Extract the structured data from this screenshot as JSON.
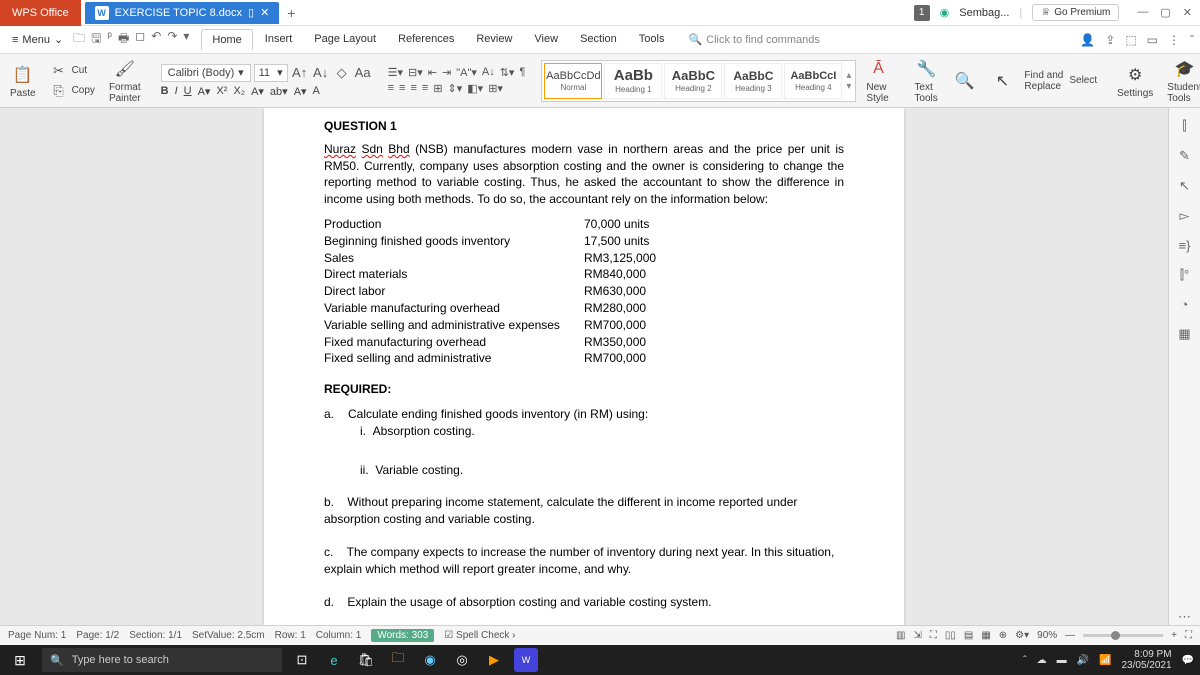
{
  "app": {
    "name": "WPS Office"
  },
  "document": {
    "filename": "EXERCISE TOPIC 8.docx"
  },
  "titlebar": {
    "user_label": "Sembag...",
    "premium_label": "Go Premium",
    "badge": "1"
  },
  "menubar": {
    "menu_label": "Menu",
    "tabs": [
      "Home",
      "Insert",
      "Page Layout",
      "References",
      "Review",
      "View",
      "Section",
      "Tools"
    ],
    "active_tab": "Home",
    "search_placeholder": "Click to find commands"
  },
  "ribbon": {
    "cut": "Cut",
    "copy": "Copy",
    "paste": "Paste",
    "format_painter": "Format\nPainter",
    "font_name": "Calibri (Body)",
    "font_size": "11",
    "styles": [
      {
        "preview": "AaBbCcDd",
        "name": "Normal"
      },
      {
        "preview": "AaBb",
        "name": "Heading 1"
      },
      {
        "preview": "AaBbC",
        "name": "Heading 2"
      },
      {
        "preview": "AaBbC",
        "name": "Heading 3"
      },
      {
        "preview": "AaBbCcI",
        "name": "Heading 4"
      }
    ],
    "new_style": "New Style",
    "text_tools": "Text Tools",
    "find_replace": "Find and\nReplace",
    "select": "Select",
    "settings": "Settings",
    "student_tools": "Student Tools"
  },
  "doc": {
    "q_title": "QUESTION 1",
    "para": "Nuraz Sdn Bhd (NSB) manufactures modern vase in northern areas and the price per unit is RM50. Currently, company uses absorption costing and the owner is considering to change the reporting method to variable costing. Thus, he asked the accountant to show the difference in income using both methods. To do so, the accountant rely on the information below:",
    "table": [
      [
        "Production",
        "70,000 units"
      ],
      [
        "Beginning finished goods inventory",
        "17,500 units"
      ],
      [
        "Sales",
        "RM3,125,000"
      ],
      [
        "Direct materials",
        "RM840,000"
      ],
      [
        "Direct labor",
        "RM630,000"
      ],
      [
        "Variable manufacturing overhead",
        "RM280,000"
      ],
      [
        "Variable selling and administrative expenses",
        "RM700,000"
      ],
      [
        "Fixed manufacturing overhead",
        "RM350,000"
      ],
      [
        "Fixed selling and administrative",
        "RM700,000"
      ]
    ],
    "required": "REQUIRED:",
    "a": "Calculate ending finished goods inventory (in RM) using:",
    "a_i": "Absorption costing.",
    "a_ii": "Variable costing.",
    "b": "Without preparing income statement, calculate the different in income reported under absorption costing and variable costing.",
    "c": "The company expects to increase the number of inventory during next year. In this situation, explain which method will report greater income, and why.",
    "d": "Explain the usage of absorption costing and variable costing system."
  },
  "statusbar": {
    "page_num": "Page Num: 1",
    "page": "Page: 1/2",
    "section": "Section: 1/1",
    "setvalue": "SetValue: 2.5cm",
    "row": "Row: 1",
    "column": "Column: 1",
    "words": "Words: 303",
    "spellcheck": "Spell Check",
    "zoom": "90%"
  },
  "taskbar": {
    "search_placeholder": "Type here to search",
    "time": "8:09 PM",
    "date": "23/05/2021"
  }
}
